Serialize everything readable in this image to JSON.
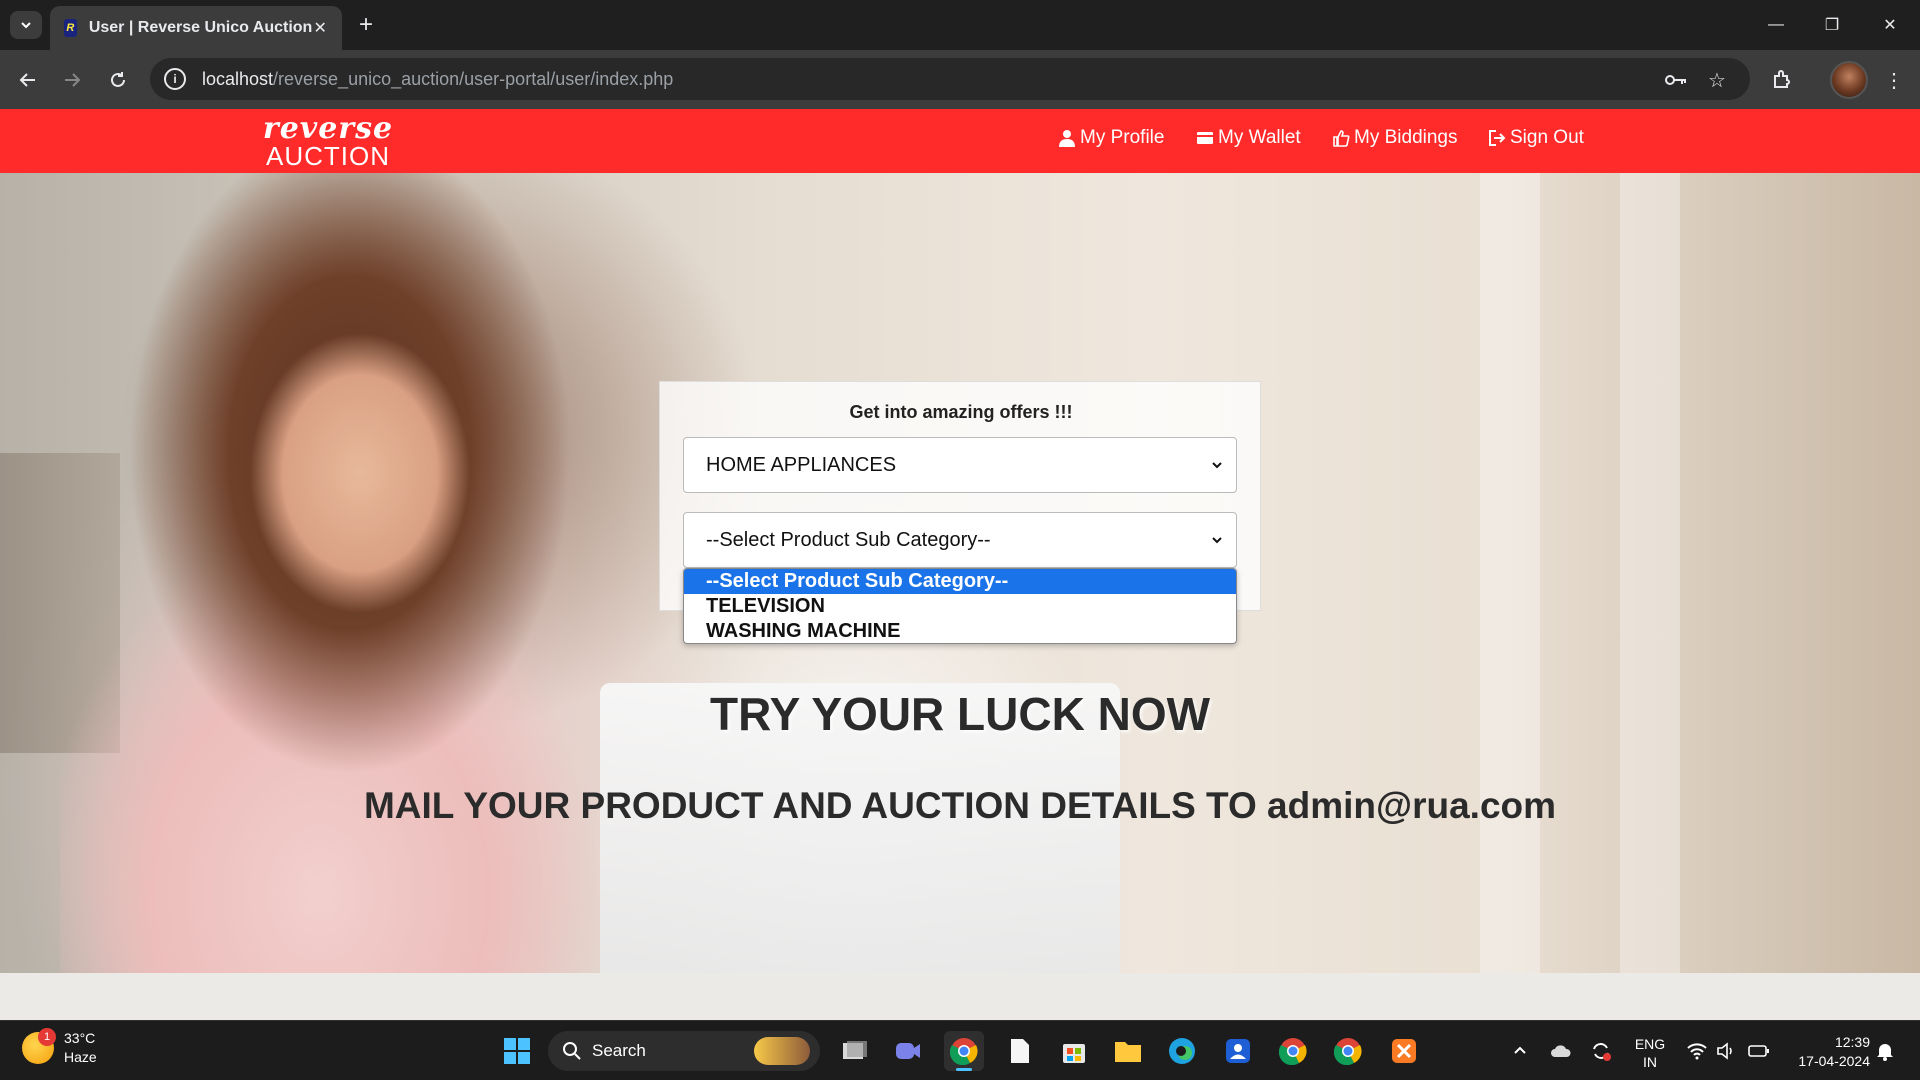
{
  "browser": {
    "tab_title": "User | Reverse Unico Auction",
    "url_host": "localhost",
    "url_path": "/reverse_unico_auction/user-portal/user/index.php"
  },
  "site": {
    "logo_top": "reverse",
    "logo_bottom": "AUCTION",
    "nav": [
      {
        "label": "My Profile",
        "icon": "user-icon"
      },
      {
        "label": "My Wallet",
        "icon": "wallet-icon"
      },
      {
        "label": "My Biddings",
        "icon": "thumbs-up-icon"
      },
      {
        "label": "Sign Out",
        "icon": "sign-out-icon"
      }
    ],
    "colors": {
      "navbar": "#ff2b2b",
      "selected_option": "#1a73e8"
    }
  },
  "form": {
    "heading": "Get into amazing offers !!!",
    "category_value": "HOME APPLIANCES",
    "subcategory_value": "--Select Product Sub Category--",
    "subcategory_options": [
      "--Select Product Sub Category--",
      "TELEVISION",
      "WASHING MACHINE"
    ]
  },
  "hero": {
    "headline": "TRY YOUR LUCK NOW",
    "subline": "MAIL YOUR PRODUCT AND AUCTION DETAILS TO admin@rua.com"
  },
  "taskbar": {
    "weather_temp": "33°C",
    "weather_desc": "Haze",
    "weather_badge": "1",
    "search_label": "Search",
    "lang_top": "ENG",
    "lang_bottom": "IN",
    "time": "12:39",
    "date": "17-04-2024"
  }
}
